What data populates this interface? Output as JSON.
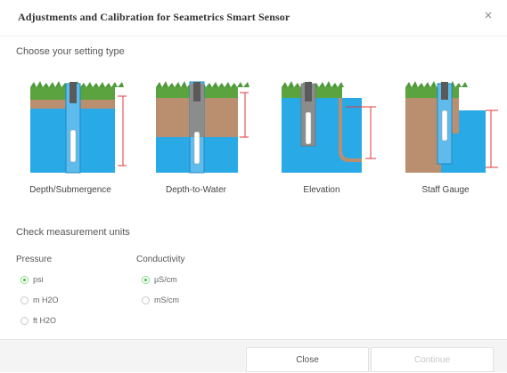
{
  "dialog": {
    "title": "Adjustments and Calibration for Seametrics Smart Sensor",
    "close_icon": "×"
  },
  "setting_type": {
    "heading": "Choose your setting type",
    "options": [
      {
        "label": "Depth/Submergence"
      },
      {
        "label": "Depth-to-Water"
      },
      {
        "label": "Elevation"
      },
      {
        "label": "Staff Gauge"
      }
    ]
  },
  "units": {
    "heading": "Check measurement units",
    "pressure": {
      "label": "Pressure",
      "options": [
        {
          "label": "psi",
          "checked": true
        },
        {
          "label": "m H2O",
          "checked": false
        },
        {
          "label": "ft H2O",
          "checked": false
        }
      ]
    },
    "conductivity": {
      "label": "Conductivity",
      "options": [
        {
          "label": "µS/cm",
          "checked": true
        },
        {
          "label": "mS/cm",
          "checked": false
        }
      ]
    }
  },
  "footer": {
    "close_label": "Close",
    "continue_label": "Continue"
  },
  "colors": {
    "water": "#29a9e6",
    "soil": "#b98f6f",
    "grass": "#4f9a3a",
    "measure_line": "#e33a3a",
    "radio_checked": "#3cb83c"
  }
}
